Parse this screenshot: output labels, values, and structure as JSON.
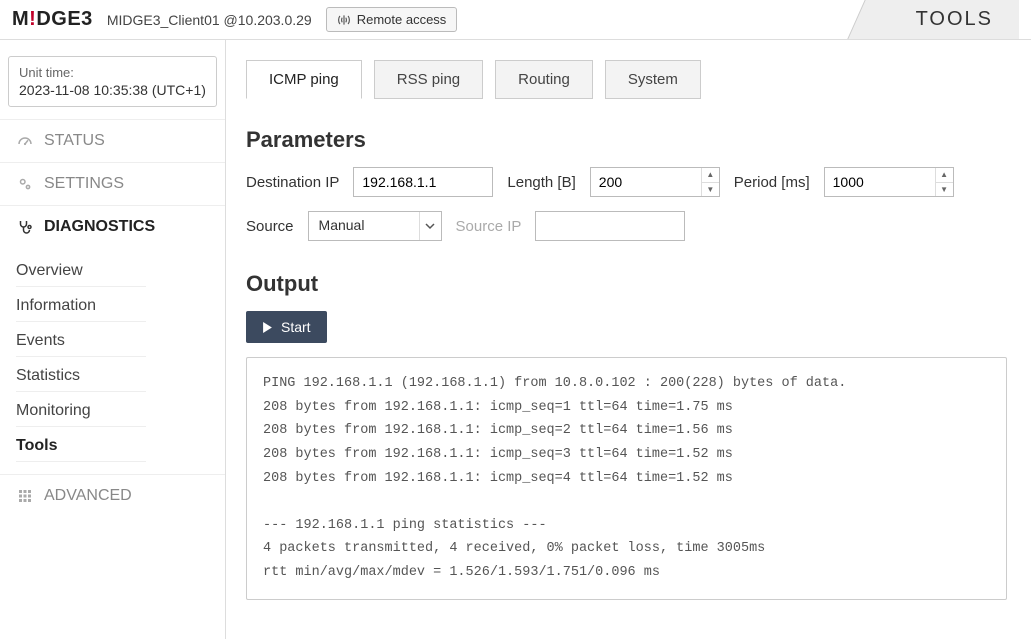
{
  "header": {
    "brand_m": "M",
    "brand_excl": "!",
    "brand_rest": "DGE3",
    "host": "MIDGE3_Client01 @10.203.0.29",
    "remote_label": "Remote access",
    "tools_label": "TOOLS"
  },
  "unit_time": {
    "label": "Unit time:",
    "value": "2023-11-08 10:35:38 (UTC+1)"
  },
  "nav": {
    "status": "STATUS",
    "settings": "SETTINGS",
    "diagnostics": "DIAGNOSTICS",
    "advanced": "ADVANCED"
  },
  "diag_items": [
    "Overview",
    "Information",
    "Events",
    "Statistics",
    "Monitoring",
    "Tools"
  ],
  "tabs": [
    "ICMP ping",
    "RSS ping",
    "Routing",
    "System"
  ],
  "params": {
    "heading": "Parameters",
    "dest_label": "Destination IP",
    "dest_value": "192.168.1.1",
    "len_label": "Length [B]",
    "len_value": "200",
    "period_label": "Period [ms]",
    "period_value": "1000",
    "source_label": "Source",
    "source_value": "Manual",
    "sourceip_label": "Source IP",
    "sourceip_value": ""
  },
  "output": {
    "heading": "Output",
    "start_label": "Start",
    "text": "PING 192.168.1.1 (192.168.1.1) from 10.8.0.102 : 200(228) bytes of data.\n208 bytes from 192.168.1.1: icmp_seq=1 ttl=64 time=1.75 ms\n208 bytes from 192.168.1.1: icmp_seq=2 ttl=64 time=1.56 ms\n208 bytes from 192.168.1.1: icmp_seq=3 ttl=64 time=1.52 ms\n208 bytes from 192.168.1.1: icmp_seq=4 ttl=64 time=1.52 ms\n\n--- 192.168.1.1 ping statistics ---\n4 packets transmitted, 4 received, 0% packet loss, time 3005ms\nrtt min/avg/max/mdev = 1.526/1.593/1.751/0.096 ms"
  }
}
